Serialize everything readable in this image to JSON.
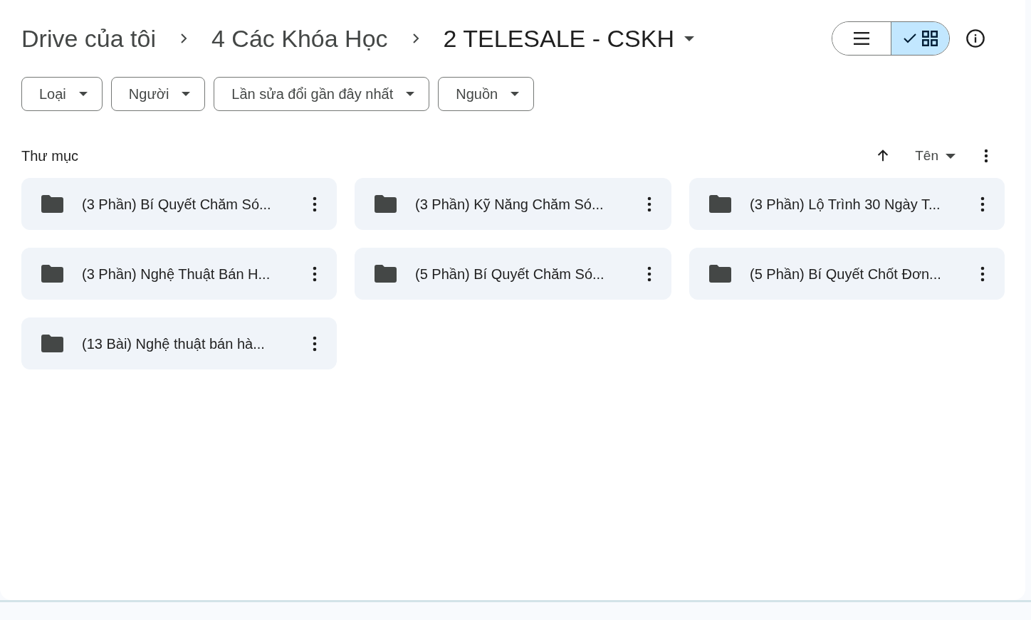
{
  "breadcrumb": [
    {
      "label": "Drive của tôi",
      "current": false
    },
    {
      "label": "4 Các Khóa Học",
      "current": false
    },
    {
      "label": "2 TELESALE - CSKH",
      "current": true
    }
  ],
  "view_toggle": [
    {
      "kind": "list",
      "selected": false
    },
    {
      "kind": "grid",
      "selected": true
    }
  ],
  "filters": [
    "Loại",
    "Người",
    "Lần sửa đổi gần đây nhất",
    "Nguồn"
  ],
  "section_title": "Thư mục",
  "sort": {
    "label": "Tên"
  },
  "folders": [
    {
      "name": "(3 Phần) Bí Quyết Chăm Só..."
    },
    {
      "name": "(3 Phần) Kỹ Năng Chăm Só..."
    },
    {
      "name": "(3 Phần) Lộ Trình 30 Ngày T..."
    },
    {
      "name": "(3 Phần) Nghệ Thuật Bán H..."
    },
    {
      "name": "(5 Phần) Bí Quyết Chăm Só..."
    },
    {
      "name": "(5 Phần) Bí Quyết Chốt Đơn..."
    },
    {
      "name": "(13 Bài) Nghệ thuật bán hà..."
    }
  ]
}
